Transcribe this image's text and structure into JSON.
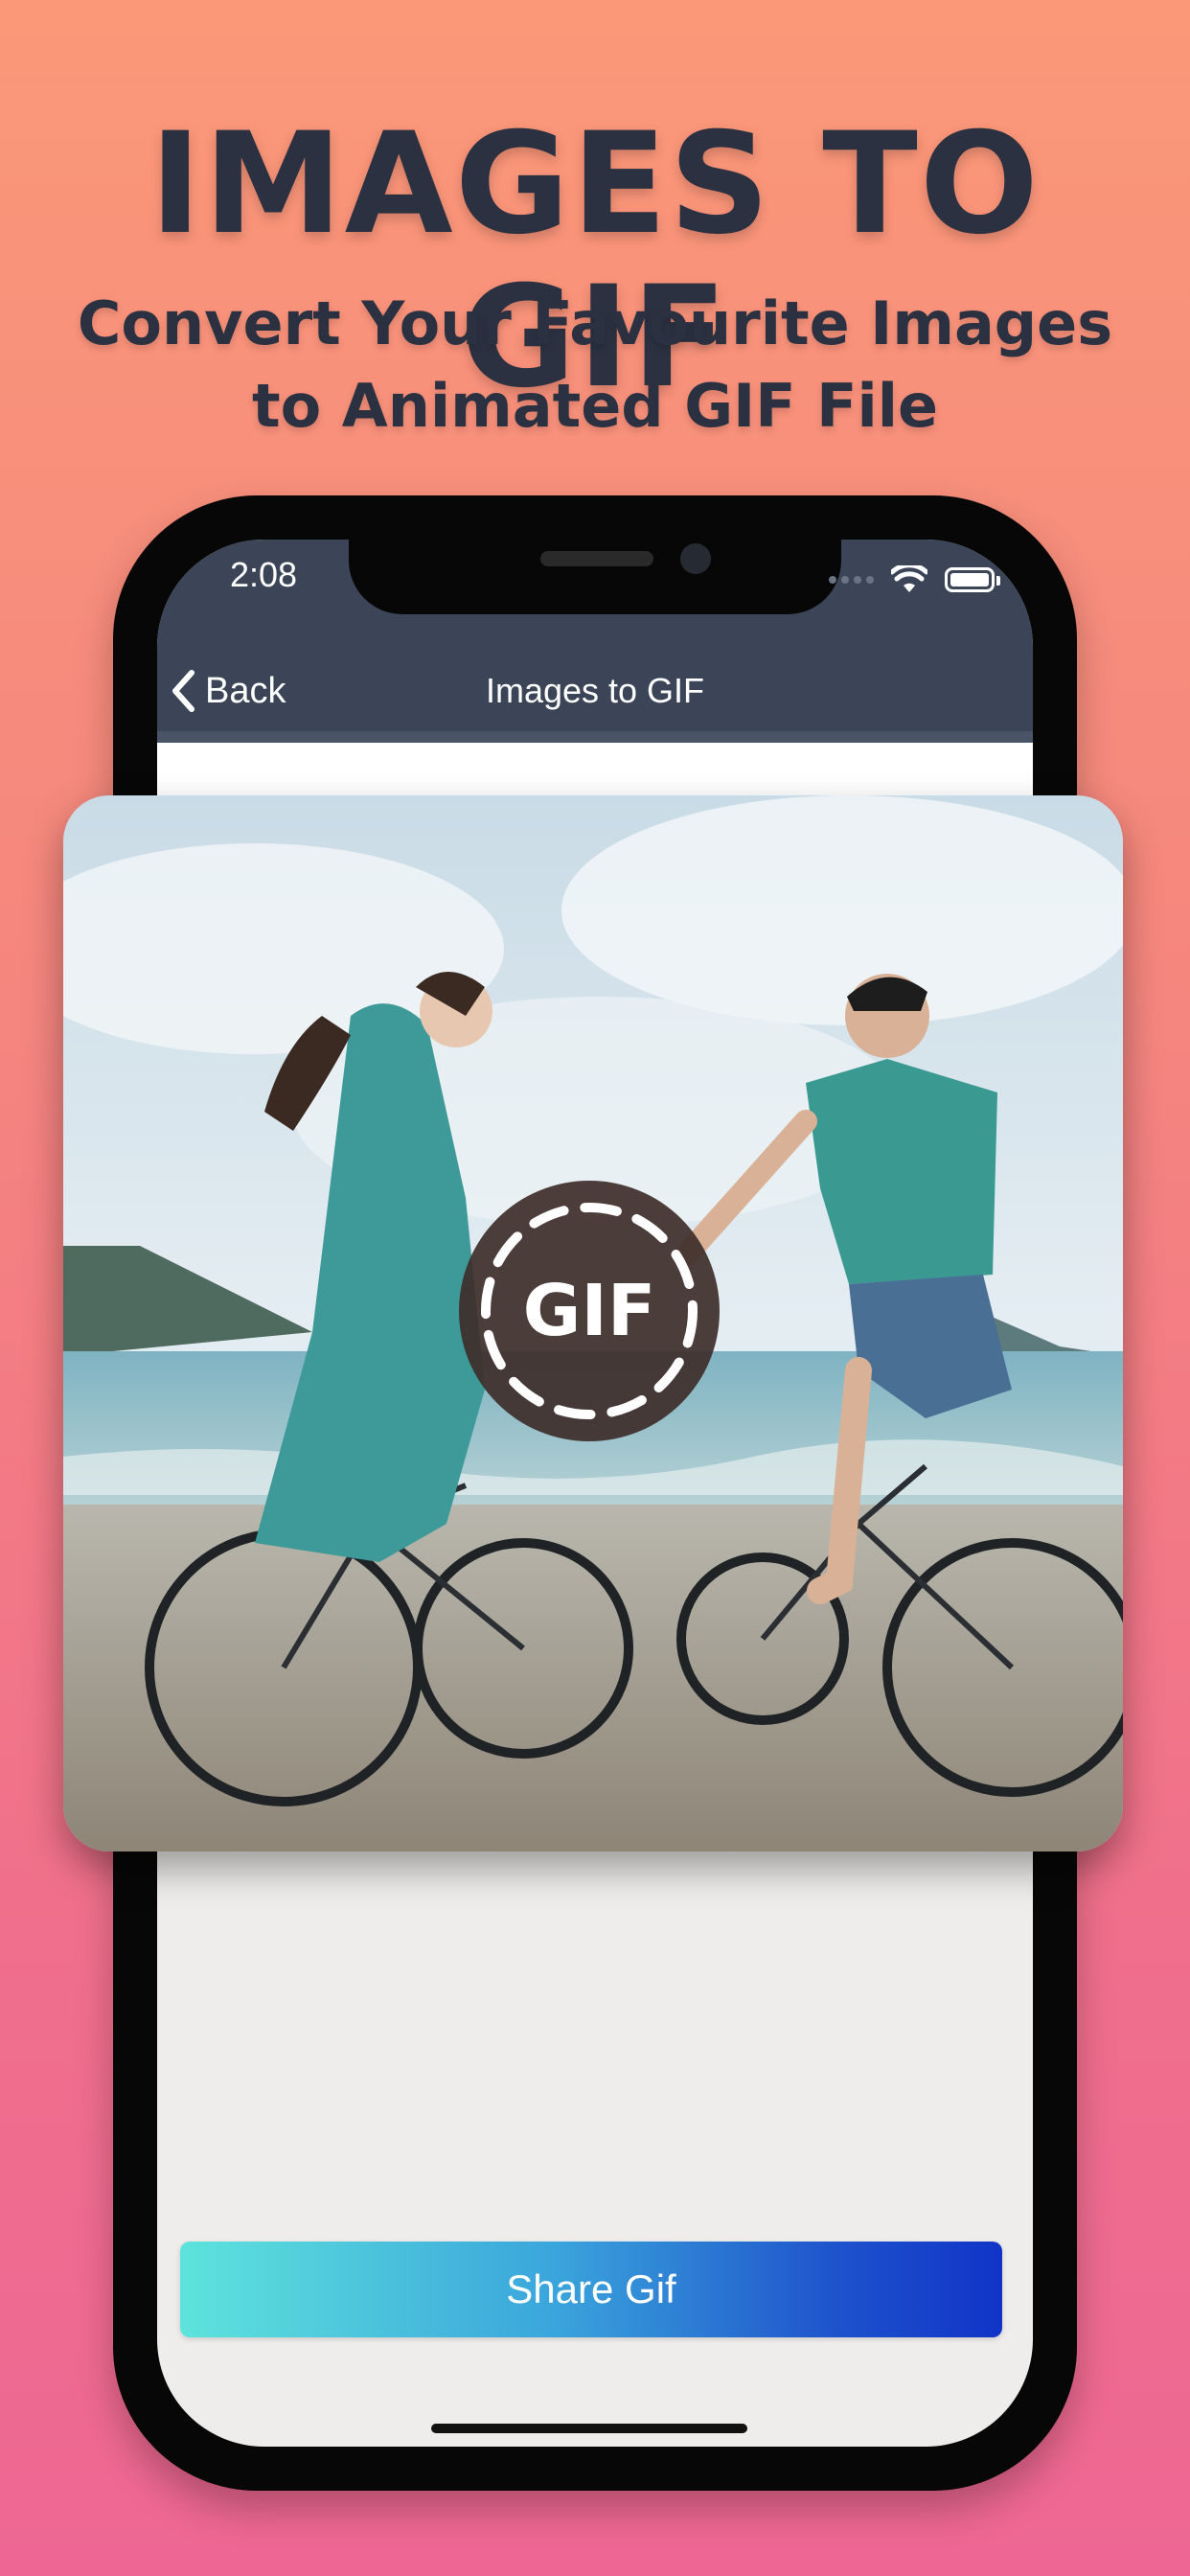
{
  "promo": {
    "headline": "IMAGES TO GIF",
    "subheadline_line1": "Convert Your Favourite Images",
    "subheadline_line2": "to Animated GIF File"
  },
  "status_bar": {
    "time": "2:08"
  },
  "navbar": {
    "back_label": "Back",
    "title": "Images to GIF"
  },
  "preview": {
    "badge_label": "GIF"
  },
  "actions": {
    "share_label": "Share Gif"
  },
  "colors": {
    "navbar": "#3b4557",
    "headline_text": "#2b3140",
    "share_gradient_start": "#5ee3dc",
    "share_gradient_end": "#1034c8"
  }
}
